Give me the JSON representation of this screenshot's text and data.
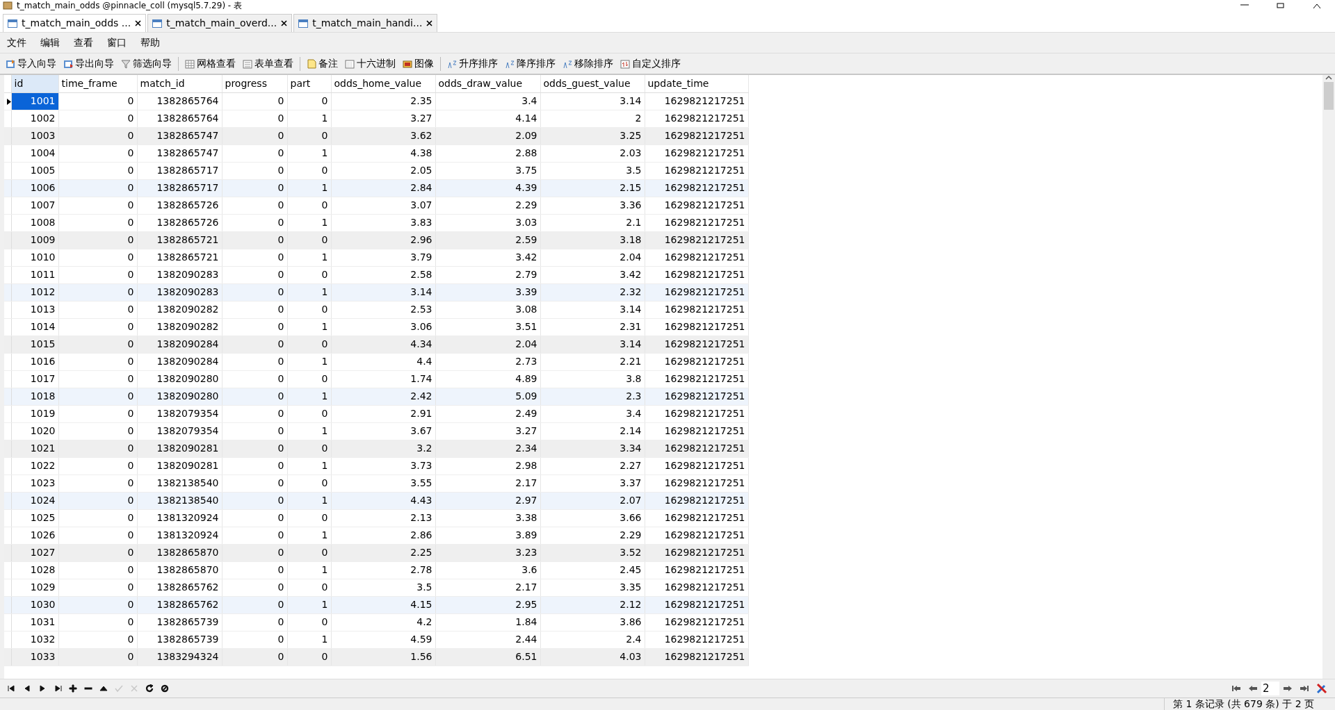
{
  "window": {
    "title": "t_match_main_odds @pinnacle_coll (mysql5.7.29) - 表"
  },
  "tabs": [
    {
      "label": "t_match_main_odds ...",
      "selected": true
    },
    {
      "label": "t_match_main_overd...",
      "selected": false
    },
    {
      "label": "t_match_main_handi...",
      "selected": false
    }
  ],
  "menu": [
    "文件",
    "编辑",
    "查看",
    "窗口",
    "帮助"
  ],
  "toolbar": [
    [
      {
        "label": "导入向导",
        "kind": "import"
      },
      {
        "label": "导出向导",
        "kind": "export"
      },
      {
        "label": "筛选向导",
        "kind": "filter"
      }
    ],
    [
      {
        "label": "网格查看",
        "kind": "grid"
      },
      {
        "label": "表单查看",
        "kind": "form"
      }
    ],
    [
      {
        "label": "备注",
        "kind": "note"
      },
      {
        "label": "十六进制",
        "kind": "hex"
      },
      {
        "label": "图像",
        "kind": "image"
      }
    ],
    [
      {
        "label": "升序排序",
        "kind": "sort"
      },
      {
        "label": "降序排序",
        "kind": "sort"
      },
      {
        "label": "移除排序",
        "kind": "sort"
      },
      {
        "label": "自定义排序",
        "kind": "custom"
      }
    ]
  ],
  "table": {
    "columns": [
      "id",
      "time_frame",
      "match_id",
      "progress",
      "part",
      "odds_home_value",
      "odds_draw_value",
      "odds_guest_value",
      "update_time"
    ],
    "rows": [
      {
        "selected": true,
        "cells": [
          "1001",
          "0",
          "1382865764",
          "0",
          "0",
          "2.35",
          "3.4",
          "3.14",
          "1629821217251"
        ]
      },
      {
        "selected": false,
        "cells": [
          "1002",
          "0",
          "1382865764",
          "0",
          "1",
          "3.27",
          "4.14",
          "2",
          "1629821217251"
        ]
      },
      {
        "selected": false,
        "cells": [
          "1003",
          "0",
          "1382865747",
          "0",
          "0",
          "3.62",
          "2.09",
          "3.25",
          "1629821217251"
        ]
      },
      {
        "selected": false,
        "cells": [
          "1004",
          "0",
          "1382865747",
          "0",
          "1",
          "4.38",
          "2.88",
          "2.03",
          "1629821217251"
        ]
      },
      {
        "selected": false,
        "cells": [
          "1005",
          "0",
          "1382865717",
          "0",
          "0",
          "2.05",
          "3.75",
          "3.5",
          "1629821217251"
        ]
      },
      {
        "selected": false,
        "cells": [
          "1006",
          "0",
          "1382865717",
          "0",
          "1",
          "2.84",
          "4.39",
          "2.15",
          "1629821217251"
        ]
      },
      {
        "selected": false,
        "cells": [
          "1007",
          "0",
          "1382865726",
          "0",
          "0",
          "3.07",
          "2.29",
          "3.36",
          "1629821217251"
        ]
      },
      {
        "selected": false,
        "cells": [
          "1008",
          "0",
          "1382865726",
          "0",
          "1",
          "3.83",
          "3.03",
          "2.1",
          "1629821217251"
        ]
      },
      {
        "selected": false,
        "cells": [
          "1009",
          "0",
          "1382865721",
          "0",
          "0",
          "2.96",
          "2.59",
          "3.18",
          "1629821217251"
        ]
      },
      {
        "selected": false,
        "cells": [
          "1010",
          "0",
          "1382865721",
          "0",
          "1",
          "3.79",
          "3.42",
          "2.04",
          "1629821217251"
        ]
      },
      {
        "selected": false,
        "cells": [
          "1011",
          "0",
          "1382090283",
          "0",
          "0",
          "2.58",
          "2.79",
          "3.42",
          "1629821217251"
        ]
      },
      {
        "selected": false,
        "cells": [
          "1012",
          "0",
          "1382090283",
          "0",
          "1",
          "3.14",
          "3.39",
          "2.32",
          "1629821217251"
        ]
      },
      {
        "selected": false,
        "cells": [
          "1013",
          "0",
          "1382090282",
          "0",
          "0",
          "2.53",
          "3.08",
          "3.14",
          "1629821217251"
        ]
      },
      {
        "selected": false,
        "cells": [
          "1014",
          "0",
          "1382090282",
          "0",
          "1",
          "3.06",
          "3.51",
          "2.31",
          "1629821217251"
        ]
      },
      {
        "selected": false,
        "cells": [
          "1015",
          "0",
          "1382090284",
          "0",
          "0",
          "4.34",
          "2.04",
          "3.14",
          "1629821217251"
        ]
      },
      {
        "selected": false,
        "cells": [
          "1016",
          "0",
          "1382090284",
          "0",
          "1",
          "4.4",
          "2.73",
          "2.21",
          "1629821217251"
        ]
      },
      {
        "selected": false,
        "cells": [
          "1017",
          "0",
          "1382090280",
          "0",
          "0",
          "1.74",
          "4.89",
          "3.8",
          "1629821217251"
        ]
      },
      {
        "selected": false,
        "cells": [
          "1018",
          "0",
          "1382090280",
          "0",
          "1",
          "2.42",
          "5.09",
          "2.3",
          "1629821217251"
        ]
      },
      {
        "selected": false,
        "cells": [
          "1019",
          "0",
          "1382079354",
          "0",
          "0",
          "2.91",
          "2.49",
          "3.4",
          "1629821217251"
        ]
      },
      {
        "selected": false,
        "cells": [
          "1020",
          "0",
          "1382079354",
          "0",
          "1",
          "3.67",
          "3.27",
          "2.14",
          "1629821217251"
        ]
      },
      {
        "selected": false,
        "cells": [
          "1021",
          "0",
          "1382090281",
          "0",
          "0",
          "3.2",
          "2.34",
          "3.34",
          "1629821217251"
        ]
      },
      {
        "selected": false,
        "cells": [
          "1022",
          "0",
          "1382090281",
          "0",
          "1",
          "3.73",
          "2.98",
          "2.27",
          "1629821217251"
        ]
      },
      {
        "selected": false,
        "cells": [
          "1023",
          "0",
          "1382138540",
          "0",
          "0",
          "3.55",
          "2.17",
          "3.37",
          "1629821217251"
        ]
      },
      {
        "selected": false,
        "cells": [
          "1024",
          "0",
          "1382138540",
          "0",
          "1",
          "4.43",
          "2.97",
          "2.07",
          "1629821217251"
        ]
      },
      {
        "selected": false,
        "cells": [
          "1025",
          "0",
          "1381320924",
          "0",
          "0",
          "2.13",
          "3.38",
          "3.66",
          "1629821217251"
        ]
      },
      {
        "selected": false,
        "cells": [
          "1026",
          "0",
          "1381320924",
          "0",
          "1",
          "2.86",
          "3.89",
          "2.29",
          "1629821217251"
        ]
      },
      {
        "selected": false,
        "cells": [
          "1027",
          "0",
          "1382865870",
          "0",
          "0",
          "2.25",
          "3.23",
          "3.52",
          "1629821217251"
        ]
      },
      {
        "selected": false,
        "cells": [
          "1028",
          "0",
          "1382865870",
          "0",
          "1",
          "2.78",
          "3.6",
          "2.45",
          "1629821217251"
        ]
      },
      {
        "selected": false,
        "cells": [
          "1029",
          "0",
          "1382865762",
          "0",
          "0",
          "3.5",
          "2.17",
          "3.35",
          "1629821217251"
        ]
      },
      {
        "selected": false,
        "cells": [
          "1030",
          "0",
          "1382865762",
          "0",
          "1",
          "4.15",
          "2.95",
          "2.12",
          "1629821217251"
        ]
      },
      {
        "selected": false,
        "cells": [
          "1031",
          "0",
          "1382865739",
          "0",
          "0",
          "4.2",
          "1.84",
          "3.86",
          "1629821217251"
        ]
      },
      {
        "selected": false,
        "cells": [
          "1032",
          "0",
          "1382865739",
          "0",
          "1",
          "4.59",
          "2.44",
          "2.4",
          "1629821217251"
        ]
      },
      {
        "selected": false,
        "cells": [
          "1033",
          "0",
          "1383294324",
          "0",
          "0",
          "1.56",
          "6.51",
          "4.03",
          "1629821217251"
        ]
      }
    ]
  },
  "record_nav": [
    {
      "kind": "first",
      "disabled": false
    },
    {
      "kind": "prev",
      "disabled": false
    },
    {
      "kind": "next",
      "disabled": false
    },
    {
      "kind": "last",
      "disabled": false
    },
    {
      "kind": "add",
      "disabled": false
    },
    {
      "kind": "delete",
      "disabled": false
    },
    {
      "kind": "up",
      "disabled": false
    },
    {
      "kind": "apply",
      "disabled": true
    },
    {
      "kind": "discard",
      "disabled": true
    },
    {
      "kind": "refresh",
      "disabled": false
    },
    {
      "kind": "stop",
      "disabled": false
    }
  ],
  "page_nav": {
    "page": "2"
  },
  "status_bar": "第 1 条记录 (共 679 条) 于 2 页"
}
